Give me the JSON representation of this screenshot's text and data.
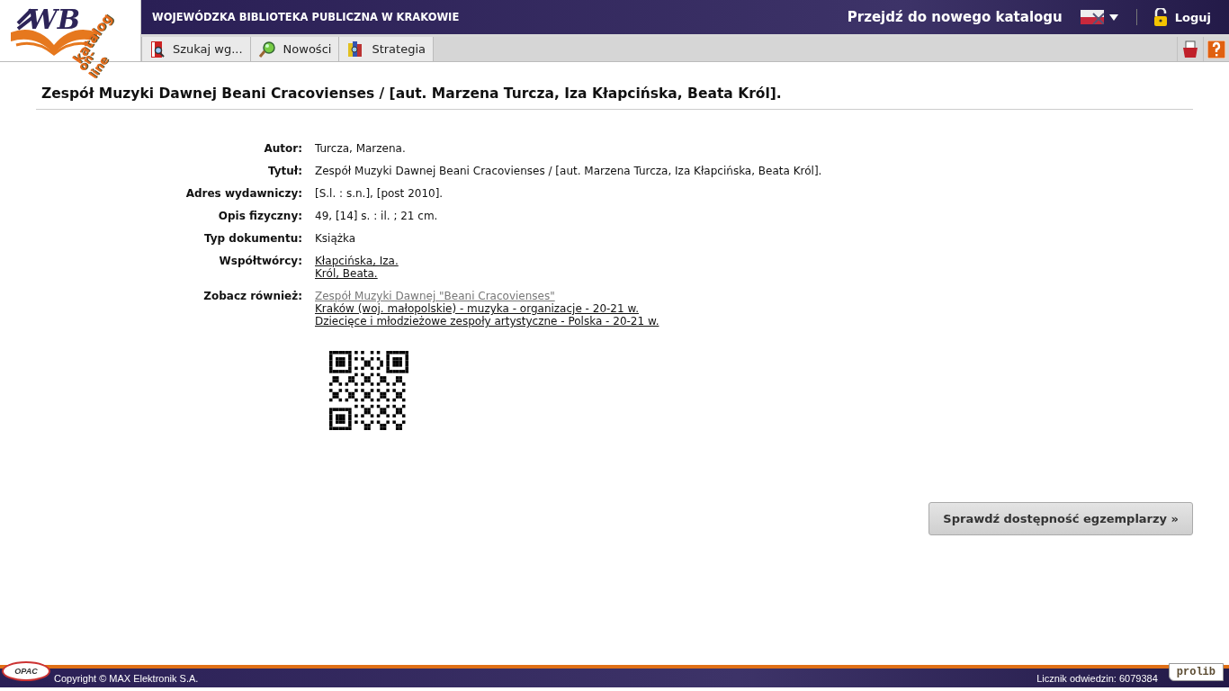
{
  "logo": {
    "line_1": "katalog",
    "line_2": "on-line",
    "letters": "WB"
  },
  "header": {
    "library_name": "WOJEWÓDZKA BIBLIOTEKA PUBLICZNA W KRAKOWIE",
    "new_catalog_link": "Przejdź do nowego katalogu",
    "login": "Loguj"
  },
  "toolbar": [
    {
      "label": "Szukaj wg..."
    },
    {
      "label": "Nowości"
    },
    {
      "label": "Strategia"
    }
  ],
  "record": {
    "title": "Zespół Muzyki Dawnej Beani Cracovienses / [aut. Marzena Turcza, Iza Kłapcińska, Beata Król].",
    "fields": [
      {
        "label": "Autor:",
        "kind": "text",
        "values": [
          {
            "text": "Turcza, Marzena."
          }
        ]
      },
      {
        "label": "Tytuł:",
        "kind": "text",
        "values": [
          {
            "text": "Zespół Muzyki Dawnej Beani Cracovienses / [aut. Marzena Turcza, Iza Kłapcińska, Beata Król]."
          }
        ]
      },
      {
        "label": "Adres wydawniczy:",
        "kind": "text",
        "values": [
          {
            "text": "[S.l. : s.n.], [post 2010]."
          }
        ]
      },
      {
        "label": "Opis fizyczny:",
        "kind": "text",
        "values": [
          {
            "text": "49, [14] s. : il. ; 21 cm."
          }
        ]
      },
      {
        "label": "Typ dokumentu:",
        "kind": "text",
        "values": [
          {
            "text": "Książka"
          }
        ]
      },
      {
        "label": "Współtwórcy:",
        "kind": "links",
        "values": [
          {
            "text": "Kłapcińska, Iza.",
            "visited": false
          },
          {
            "text": "Król, Beata.",
            "visited": false
          }
        ]
      },
      {
        "label": "Zobacz również:",
        "kind": "links",
        "values": [
          {
            "text": "Zespół Muzyki Dawnej \"Beani Cracovienses\"",
            "visited": true
          },
          {
            "text": "Kraków (woj. małopolskie) - muzyka - organizacje - 20-21 w.",
            "visited": false
          },
          {
            "text": "Dziecięce i młodzieżowe zespoły artystyczne - Polska - 20-21 w.",
            "visited": false
          }
        ]
      }
    ],
    "availability_button": "Sprawdź dostępność egzemplarzy »"
  },
  "footer": {
    "opac_logo": "OPAC",
    "copyright": "Copyright © MAX Elektronik S.A.",
    "visit_counter": "Licznik odwiedzin: 6079384",
    "prolib_logo": "prolib"
  }
}
